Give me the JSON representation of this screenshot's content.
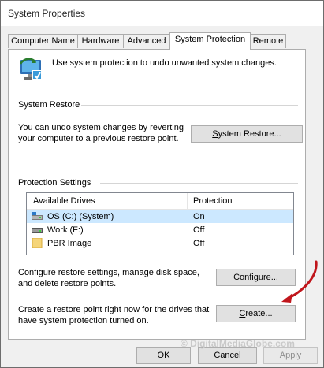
{
  "window": {
    "title": "System Properties"
  },
  "tabs": [
    {
      "label": "Computer Name",
      "active": false
    },
    {
      "label": "Hardware",
      "active": false
    },
    {
      "label": "Advanced",
      "active": false
    },
    {
      "label": "System Protection",
      "active": true
    },
    {
      "label": "Remote",
      "active": false
    }
  ],
  "header": {
    "description": "Use system protection to undo unwanted system changes."
  },
  "restore": {
    "heading": "System Restore",
    "text_line1": "You can undo system changes by reverting",
    "text_line2": "your computer to a previous restore point.",
    "button_first": "S",
    "button_rest": "ystem Restore..."
  },
  "protection": {
    "heading": "Protection Settings",
    "columns": [
      "Available Drives",
      "Protection"
    ],
    "drives": [
      {
        "name": "OS (C:) (System)",
        "protection": "On",
        "icon": "system-drive-icon",
        "selected": true
      },
      {
        "name": "Work (F:)",
        "protection": "Off",
        "icon": "drive-icon",
        "selected": false
      },
      {
        "name": "PBR Image",
        "protection": "Off",
        "icon": "folder-icon",
        "selected": false
      }
    ],
    "configure_line1": "Configure restore settings, manage disk space,",
    "configure_line2": "and delete restore points.",
    "configure_first": "C",
    "configure_rest": "onfigure...",
    "create_line1": "Create a restore point right now for the drives that",
    "create_line2": "have system protection turned on.",
    "create_first": "C",
    "create_rest": "reate..."
  },
  "footer": {
    "ok": "OK",
    "cancel": "Cancel",
    "apply_first": "A",
    "apply_rest": "pply"
  },
  "watermark": "© DigitalMediaGlobe.com",
  "colors": {
    "arrow": "#c0161c",
    "selection": "#cce8ff",
    "folder": "#f5d57a"
  }
}
